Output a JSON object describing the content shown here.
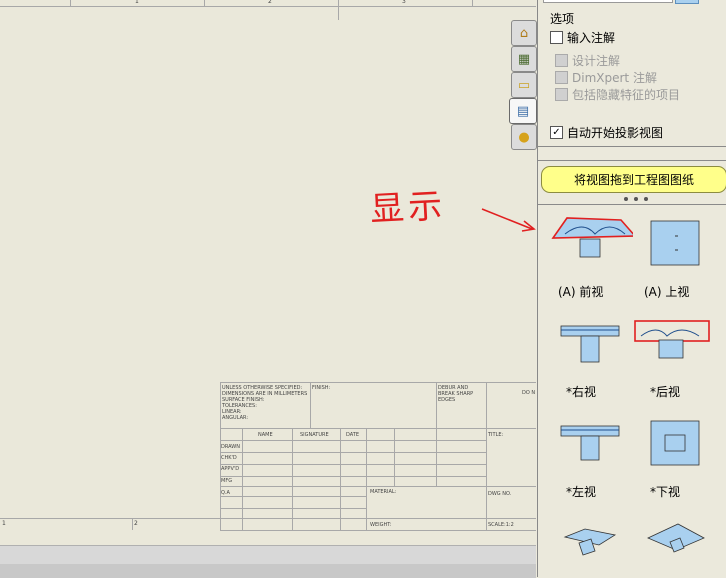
{
  "sheet": {
    "zone_numbers_top": [
      "1",
      "2",
      "3"
    ],
    "zone_numbers_bottom": [
      "1",
      "2"
    ],
    "title_block": {
      "tolerance_note": "UNLESS OTHERWISE SPECIFIED:\nDIMENSIONS ARE IN MILLIMETERS\nSURFACE FINISH:\nTOLERANCES:\n  LINEAR:\n  ANGULAR:",
      "finish": "FINISH:",
      "deburr": "DEBUR AND\nBREAK SHARP\nEDGES",
      "do_not_scale": "DO N",
      "col_name": "NAME",
      "col_signature": "SIGNATURE",
      "col_date": "DATE",
      "title": "TITLE:",
      "rows": [
        "DRAWN",
        "CHK'D",
        "APPV'D",
        "MFG",
        "Q.A"
      ],
      "material": "MATERIAL:",
      "dwg_no": "DWG NO.",
      "weight": "WEIGHT:",
      "scale": "SCALE:1:2"
    }
  },
  "annotation": {
    "text": "显示",
    "color": "#e12020"
  },
  "task_pane_tabs": [
    {
      "icon": "home-icon",
      "glyph": "⌂"
    },
    {
      "icon": "design-library-icon",
      "glyph": "▦"
    },
    {
      "icon": "folder-icon",
      "glyph": "▭"
    },
    {
      "icon": "view-palette-icon",
      "glyph": "▤"
    },
    {
      "icon": "appearance-icon",
      "glyph": "●"
    }
  ],
  "panel": {
    "options_title": "选项",
    "import_annotations": {
      "label": "输入注解",
      "checked": false
    },
    "design_annotations": {
      "label": "设计注解",
      "checked": false,
      "enabled": false
    },
    "dimxpert_annotations": {
      "label": "DimXpert 注解",
      "checked": false,
      "enabled": false
    },
    "hidden_features": {
      "label": "包括隐藏特征的项目",
      "checked": false,
      "enabled": false
    },
    "auto_projection": {
      "label": "自动开始投影视图",
      "checked": true
    },
    "drag_banner": "将视图拖到工程图图纸",
    "views": [
      {
        "label": "(A) 前视",
        "icon": "front-view-icon"
      },
      {
        "label": "(A) 上视",
        "icon": "top-view-icon"
      },
      {
        "label": "*右视",
        "icon": "right-view-icon"
      },
      {
        "label": "*后视",
        "icon": "back-view-icon"
      },
      {
        "label": "*左视",
        "icon": "left-view-icon"
      },
      {
        "label": "*下视",
        "icon": "bottom-view-icon"
      },
      {
        "label": "",
        "icon": "isometric-view-icon"
      },
      {
        "label": "",
        "icon": "dimetric-view-icon"
      }
    ],
    "accent_color": "#a9d0ef",
    "banner_color": "#ffff8a"
  }
}
